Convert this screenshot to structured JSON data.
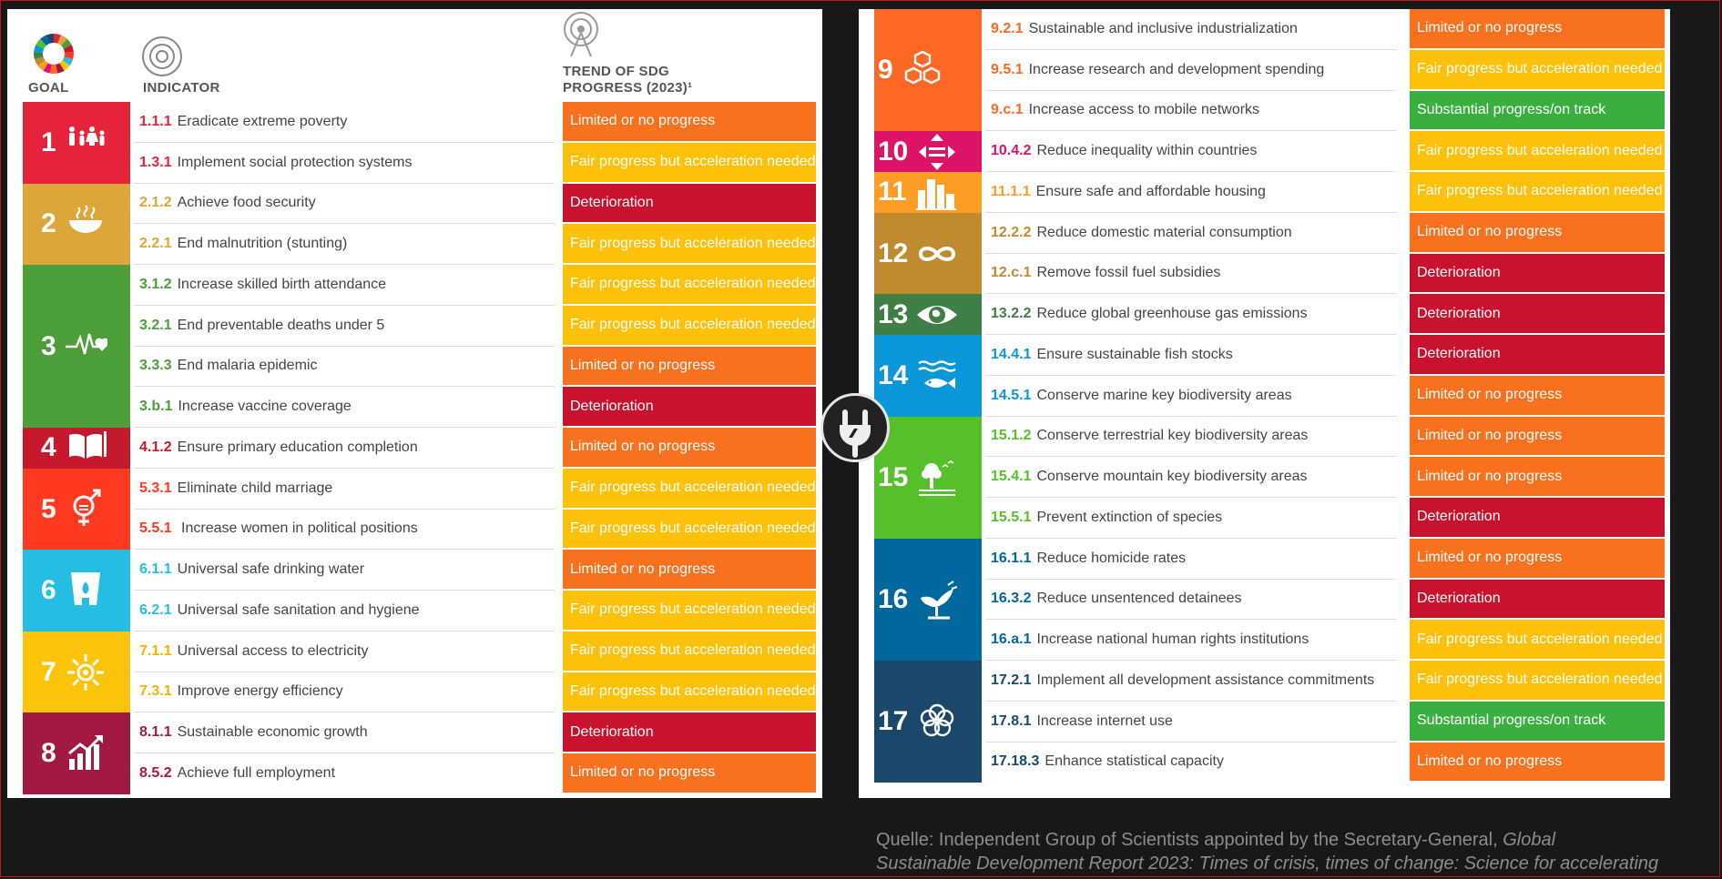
{
  "headers": {
    "goal": "GOAL",
    "indicator": "INDICATOR",
    "trend_line1": "TREND OF SDG",
    "trend_line2": "PROGRESS (2023)¹"
  },
  "colors": {
    "limited": "#f7711e",
    "fair": "#fdc10b",
    "deterioration": "#c9132e",
    "substantial": "#3aaf3f"
  },
  "left_goals": [
    {
      "number": "1",
      "icon": "family-icon",
      "color": "#e5243b"
    },
    {
      "number": "2",
      "icon": "food-bowl-icon",
      "color": "#dda63a"
    },
    {
      "number": "3",
      "icon": "heartbeat-icon",
      "color": "#4c9f38"
    },
    {
      "number": "4",
      "icon": "book-icon",
      "color": "#c5192d"
    },
    {
      "number": "5",
      "icon": "gender-icon",
      "color": "#ff3a21"
    },
    {
      "number": "6",
      "icon": "water-drop-icon",
      "color": "#26bde2"
    },
    {
      "number": "7",
      "icon": "sun-icon",
      "color": "#fcc30b"
    },
    {
      "number": "8",
      "icon": "growth-chart-icon",
      "color": "#a21942"
    }
  ],
  "right_goals": [
    {
      "number": "9",
      "icon": "cubes-icon",
      "color": "#fd6925"
    },
    {
      "number": "10",
      "icon": "arrows-icon",
      "color": "#dd1367"
    },
    {
      "number": "11",
      "icon": "city-icon",
      "color": "#fd9d24"
    },
    {
      "number": "12",
      "icon": "infinity-icon",
      "color": "#bf8b2e"
    },
    {
      "number": "13",
      "icon": "eye-globe-icon",
      "color": "#3f7e44"
    },
    {
      "number": "14",
      "icon": "fish-icon",
      "color": "#0a97d9"
    },
    {
      "number": "15",
      "icon": "tree-icon",
      "color": "#56c02b"
    },
    {
      "number": "16",
      "icon": "dove-icon",
      "color": "#00689d"
    },
    {
      "number": "17",
      "icon": "flower-icon",
      "color": "#19486a"
    }
  ],
  "left_rows": [
    {
      "code": "1.1.1",
      "text": "Eradicate extreme poverty",
      "trend": "Limited or no progress",
      "status": "limited"
    },
    {
      "code": "1.3.1",
      "text": "Implement social protection systems",
      "trend": "Fair progress but acceleration needed",
      "status": "fair"
    },
    {
      "code": "2.1.2",
      "text": "Achieve food security",
      "trend": "Deterioration",
      "status": "deterioration"
    },
    {
      "code": "2.2.1",
      "text": "End malnutrition (stunting)",
      "trend": "Fair progress but acceleration needed",
      "status": "fair"
    },
    {
      "code": "3.1.2",
      "text": "Increase skilled birth attendance",
      "trend": "Fair progress but acceleration needed",
      "status": "fair"
    },
    {
      "code": "3.2.1",
      "text": "End preventable deaths under 5",
      "trend": "Fair progress but acceleration needed",
      "status": "fair"
    },
    {
      "code": "3.3.3",
      "text": "End malaria epidemic",
      "trend": "Limited or no progress",
      "status": "limited"
    },
    {
      "code": "3.b.1",
      "text": "Increase vaccine coverage",
      "trend": "Deterioration",
      "status": "deterioration"
    },
    {
      "code": "4.1.2",
      "text": "Ensure primary education completion",
      "trend": "Limited or no progress",
      "status": "limited"
    },
    {
      "code": "5.3.1",
      "text": "Eliminate child marriage",
      "trend": "Fair progress but acceleration needed",
      "status": "fair"
    },
    {
      "code": "5.5.1",
      "text": " Increase women in political positions",
      "trend": "Fair progress but acceleration needed",
      "status": "fair"
    },
    {
      "code": "6.1.1",
      "text": "Universal safe drinking water",
      "trend": "Limited or no progress",
      "status": "limited"
    },
    {
      "code": "6.2.1",
      "text": "Universal safe sanitation and hygiene",
      "trend": "Fair progress but acceleration needed",
      "status": "fair"
    },
    {
      "code": "7.1.1",
      "text": "Universal access to electricity",
      "trend": "Fair progress but acceleration needed",
      "status": "fair"
    },
    {
      "code": "7.3.1",
      "text": "Improve energy efficiency",
      "trend": "Fair progress but acceleration needed",
      "status": "fair"
    },
    {
      "code": "8.1.1",
      "text": "Sustainable economic growth",
      "trend": "Deterioration",
      "status": "deterioration"
    },
    {
      "code": "8.5.2",
      "text": "Achieve full employment",
      "trend": "Limited or no progress",
      "status": "limited"
    }
  ],
  "right_rows": [
    {
      "code": "9.2.1",
      "text": "Sustainable and inclusive industrialization",
      "trend": "Limited or no progress",
      "status": "limited"
    },
    {
      "code": "9.5.1",
      "text": "Increase research and development spending",
      "trend": "Fair progress but acceleration needed",
      "status": "fair"
    },
    {
      "code": "9.c.1",
      "text": "Increase access to mobile networks",
      "trend": "Substantial progress/on track",
      "status": "substantial"
    },
    {
      "code": "10.4.2",
      "text": "Reduce inequality within countries",
      "trend": "Fair progress but acceleration needed",
      "status": "fair"
    },
    {
      "code": "11.1.1",
      "text": "Ensure safe and affordable housing",
      "trend": "Fair progress but acceleration needed",
      "status": "fair"
    },
    {
      "code": "12.2.2",
      "text": "Reduce domestic material consumption",
      "trend": "Limited or no progress",
      "status": "limited"
    },
    {
      "code": "12.c.1",
      "text": "Remove fossil fuel subsidies",
      "trend": "Deterioration",
      "status": "deterioration"
    },
    {
      "code": "13.2.2",
      "text": "Reduce global greenhouse gas emissions",
      "trend": "Deterioration",
      "status": "deterioration"
    },
    {
      "code": "14.4.1",
      "text": "Ensure sustainable fish stocks",
      "trend": "Deterioration",
      "status": "deterioration"
    },
    {
      "code": "14.5.1",
      "text": "Conserve marine key biodiversity areas",
      "trend": "Limited or no progress",
      "status": "limited"
    },
    {
      "code": "15.1.2",
      "text": "Conserve terrestrial key biodiversity areas",
      "trend": "Limited or no progress",
      "status": "limited"
    },
    {
      "code": "15.4.1",
      "text": "Conserve mountain key biodiversity areas",
      "trend": "Limited or no progress",
      "status": "limited"
    },
    {
      "code": "15.5.1",
      "text": "Prevent extinction of species",
      "trend": "Deterioration",
      "status": "deterioration"
    },
    {
      "code": "16.1.1",
      "text": "Reduce homicide rates",
      "trend": "Limited or no progress",
      "status": "limited"
    },
    {
      "code": "16.3.2",
      "text": "Reduce unsentenced detainees",
      "trend": "Deterioration",
      "status": "deterioration"
    },
    {
      "code": "16.a.1",
      "text": "Increase national human rights institutions",
      "trend": "Fair progress but acceleration needed",
      "status": "fair"
    },
    {
      "code": "17.2.1",
      "text": "Implement all development assistance commitments",
      "trend": "Fair progress but acceleration needed",
      "status": "fair"
    },
    {
      "code": "17.8.1",
      "text": "Increase internet use",
      "trend": "Substantial progress/on track",
      "status": "substantial"
    },
    {
      "code": "17.18.3",
      "text": "Enhance statistical capacity",
      "trend": "Limited or no progress",
      "status": "limited"
    }
  ],
  "source": {
    "prefix": "Quelle:  Independent Group of Scientists appointed by the Secretary-General, ",
    "italic1": "Global",
    "italic2": "Sustainable Development Report 2023: Times of crisis, times of change: Science for accelerating"
  }
}
